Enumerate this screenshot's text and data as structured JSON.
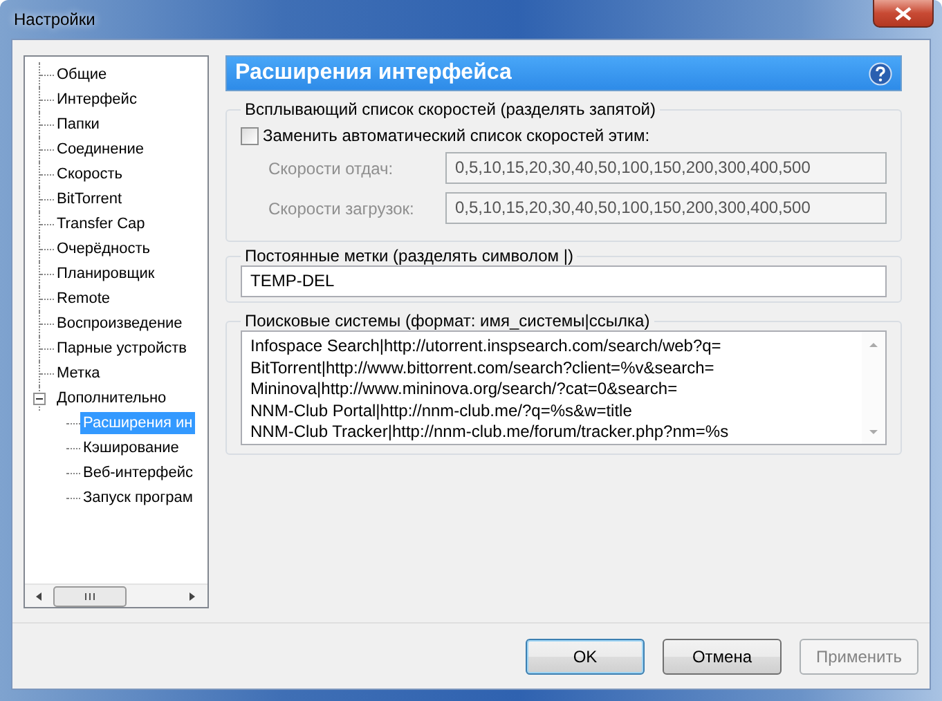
{
  "window": {
    "title": "Настройки"
  },
  "tree": [
    {
      "label": "Общие",
      "selected": false
    },
    {
      "label": "Интерфейс",
      "selected": false
    },
    {
      "label": "Папки",
      "selected": false
    },
    {
      "label": "Соединение",
      "selected": false
    },
    {
      "label": "Скорость",
      "selected": false
    },
    {
      "label": "BitTorrent",
      "selected": false
    },
    {
      "label": "Transfer Cap",
      "selected": false
    },
    {
      "label": "Очерёдность",
      "selected": false
    },
    {
      "label": "Планировщик",
      "selected": false
    },
    {
      "label": "Remote",
      "selected": false
    },
    {
      "label": "Воспроизведение",
      "selected": false
    },
    {
      "label": "Парные устройств",
      "selected": false
    },
    {
      "label": "Метка",
      "selected": false
    },
    {
      "label": "Дополнительно",
      "selected": false,
      "expanded": true,
      "children": [
        {
          "label": "Расширения ин",
          "selected": true
        },
        {
          "label": "Кэширование",
          "selected": false
        },
        {
          "label": "Веб-интерфейс",
          "selected": false
        },
        {
          "label": "Запуск програм",
          "selected": false
        }
      ]
    }
  ],
  "page": {
    "title": "Расширения интерфейса",
    "speed_group": {
      "legend": "Всплывающий список скоростей (разделять запятой)",
      "checkbox": {
        "label": "Заменить автоматический список скоростей этим:",
        "checked": false
      },
      "fields": [
        {
          "label": "Скорости отдач:",
          "value": "0,5,10,15,20,30,40,50,100,150,200,300,400,500",
          "disabled": true
        },
        {
          "label": "Скорости загрузок:",
          "value": "0,5,10,15,20,30,40,50,100,150,200,300,400,500",
          "disabled": true
        }
      ]
    },
    "labels_group": {
      "legend": "Постоянные метки (разделять символом |)",
      "value": "TEMP-DEL"
    },
    "search_group": {
      "legend": "Поисковые системы (формат: имя_системы|ссылка)",
      "lines": [
        "Infospace Search|http://utorrent.inspsearch.com/search/web?q=",
        "BitTorrent|http://www.bittorrent.com/search?client=%v&search=",
        "Mininova|http://www.mininova.org/search/?cat=0&search=",
        "NNM-Club Portal|http://nnm-club.me/?q=%s&w=title",
        "NNM-Club Tracker|http://nnm-club.me/forum/tracker.php?nm=%s"
      ]
    }
  },
  "buttons": [
    {
      "label": "OK",
      "default": true,
      "disabled": false
    },
    {
      "label": "Отмена",
      "default": false,
      "disabled": false
    },
    {
      "label": "Применить",
      "default": false,
      "disabled": true
    }
  ]
}
